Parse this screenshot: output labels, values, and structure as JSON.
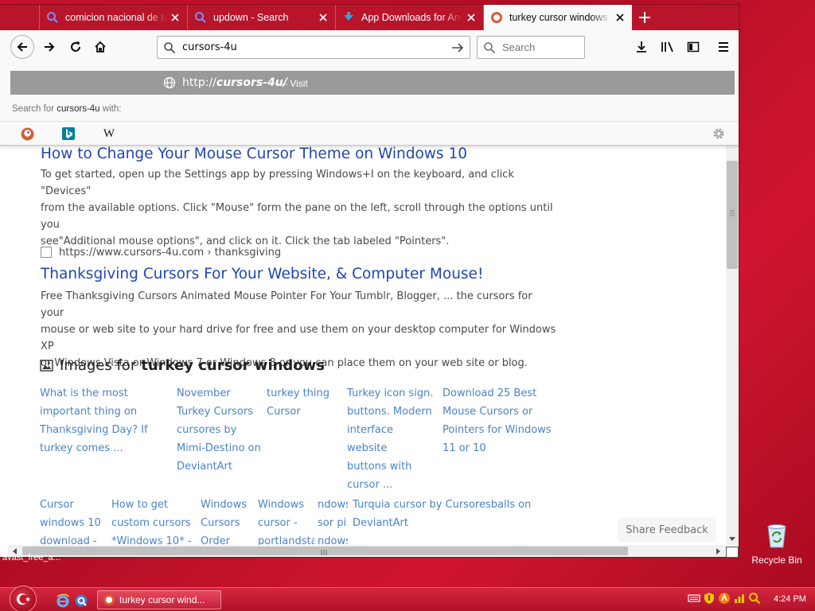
{
  "browser": {
    "tabs": [
      {
        "title": "comicion nacional de tr",
        "icon": "search-icon"
      },
      {
        "title": "updown - Search",
        "icon": "search-icon"
      },
      {
        "title": "App Downloads for Andr",
        "icon": "download-icon"
      },
      {
        "title": "turkey cursor windows",
        "icon": "duckduckgo-icon",
        "active": true
      }
    ],
    "url_value": "cursors-4u",
    "search_placeholder": "Search",
    "dropdown": {
      "suggestion_prefix": "http://",
      "suggestion_domain": "cursors-4u/",
      "suggestion_visit": "— Visit",
      "search_for_prefix": "Search for ",
      "search_for_term": "cursors-4u",
      "search_for_suffix": " with:",
      "engines": [
        "duckduckgo-icon",
        "bing-icon",
        "wikipedia-icon"
      ],
      "wikipedia_glyph": "W"
    }
  },
  "page": {
    "result1": {
      "title": "How to Change Your Mouse Cursor Theme on Windows 10",
      "snippet_lines": [
        "To get started, open up the Settings app by pressing Windows+I on the keyboard, and click \"Devices\"",
        "from the available options. Click \"Mouse\" form the pane on the left, scroll through the options until you",
        "see\"Additional mouse options\", and click on it. Click the tab labeled \"Pointers\"."
      ]
    },
    "result2": {
      "url": "https://www.cursors-4u.com › thanksgiving",
      "title": "Thanksgiving Cursors For Your Website, & Computer Mouse!",
      "snippet_lines": [
        "Free Thanksgiving Cursors Animated Mouse Pointer For Your Tumblr, Blogger, ... the cursors for your",
        "mouse or web site to your hard drive for free and use them on your desktop computer for Windows XP",
        "or Windows Vista or Windows 7 or Windows 8 or you can place them on your web site or blog."
      ]
    },
    "images": {
      "heading_prefix": "Images for",
      "heading_query": "turkey cursor windows",
      "row1": [
        [
          "What is the most",
          "important thing on",
          "Thanksgiving Day? If",
          "turkey comes ..."
        ],
        [
          "November",
          "Turkey Cursors",
          "cursores by",
          "Mimi-Destino on",
          "DeviantArt"
        ],
        [
          "turkey thing",
          "Cursor"
        ],
        [
          "Turkey icon sign.",
          "buttons. Modern",
          "interface website",
          "buttons with",
          "cursor ..."
        ],
        [
          "Download 25 Best",
          "Mouse Cursors or",
          "Pointers for Windows",
          "11 or 10"
        ]
      ],
      "row2": [
        [
          "Cursor",
          "windows 10",
          "download -"
        ],
        [
          "How to get",
          "custom cursors",
          "*Windows 10* -"
        ],
        [
          "Windows",
          "Cursors",
          "Order"
        ],
        [
          "Windows",
          "cursor -",
          "portlandstar"
        ],
        [
          "ndows",
          "sor pi",
          "ndows"
        ],
        [
          "Turquia cursor by Cursoresballs on",
          "DeviantArt"
        ]
      ]
    },
    "share_feedback": "Share Feedback"
  },
  "desktop": {
    "recycle_bin": "Recycle Bin",
    "file_label": "avast_free_a..."
  },
  "taskbar": {
    "active_window": "turkey cursor wind...",
    "clock": "4:24 PM"
  }
}
